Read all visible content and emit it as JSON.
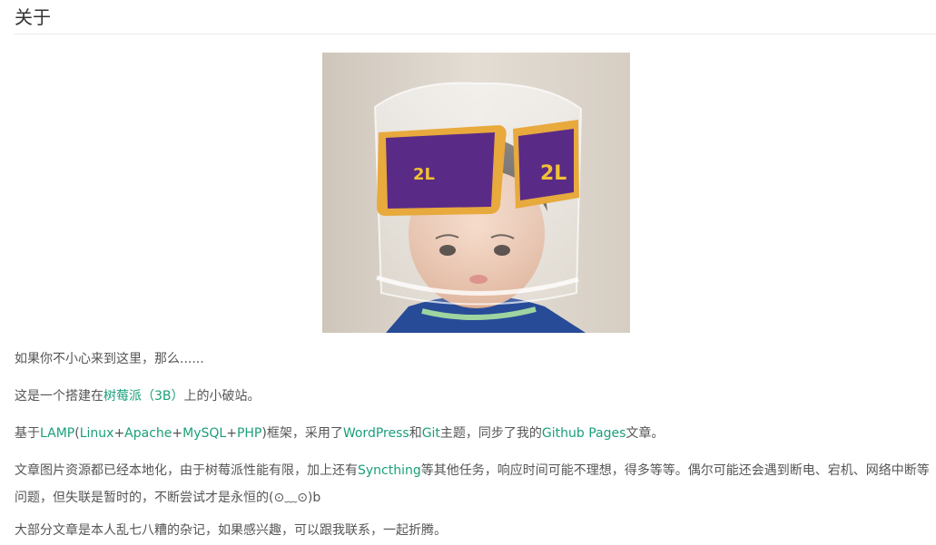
{
  "page": {
    "title": "关于"
  },
  "photo": {
    "alt": "小孩头戴剪开的塑料瓶",
    "label_text_front": "2L",
    "label_text_side": "2L"
  },
  "paragraphs": {
    "p1": "如果你不小心来到这里，那么......",
    "p2": {
      "t1": "这是一个搭建在",
      "link_raspberry": "树莓派（3B）",
      "t2": "上的小破站。"
    },
    "p3": {
      "t1": "基于",
      "link_lamp": "LAMP",
      "t2": "(",
      "link_linux": "Linux",
      "t3": "+",
      "link_apache": "Apache",
      "t4": "+",
      "link_mysql": "MySQL",
      "t5": "+",
      "link_php": "PHP",
      "t6": ")框架，采用了",
      "link_wordpress": "WordPress",
      "t7": "和",
      "link_git": "Git",
      "t8": "主题，同步了我的",
      "link_github": "Github Pages",
      "t9": "文章。"
    },
    "p4": {
      "t1": "文章图片资源都已经本地化，由于树莓派性能有限，加上还有",
      "link_syncthing": "Syncthing",
      "t2": "等其他任务，响应时间可能不理想，得多等等。偶尔可能还会遇到断电、宕机、网络中断等问题，但失联是暂时的，不断尝试才是永恒的(⊙﹏⊙)b"
    },
    "p5": "大部分文章是本人乱七八糟的杂记，如果感兴趣，可以跟我联系，一起折腾。"
  },
  "colors": {
    "link": "#1a9f7a",
    "text": "#555555",
    "title": "#333333"
  }
}
